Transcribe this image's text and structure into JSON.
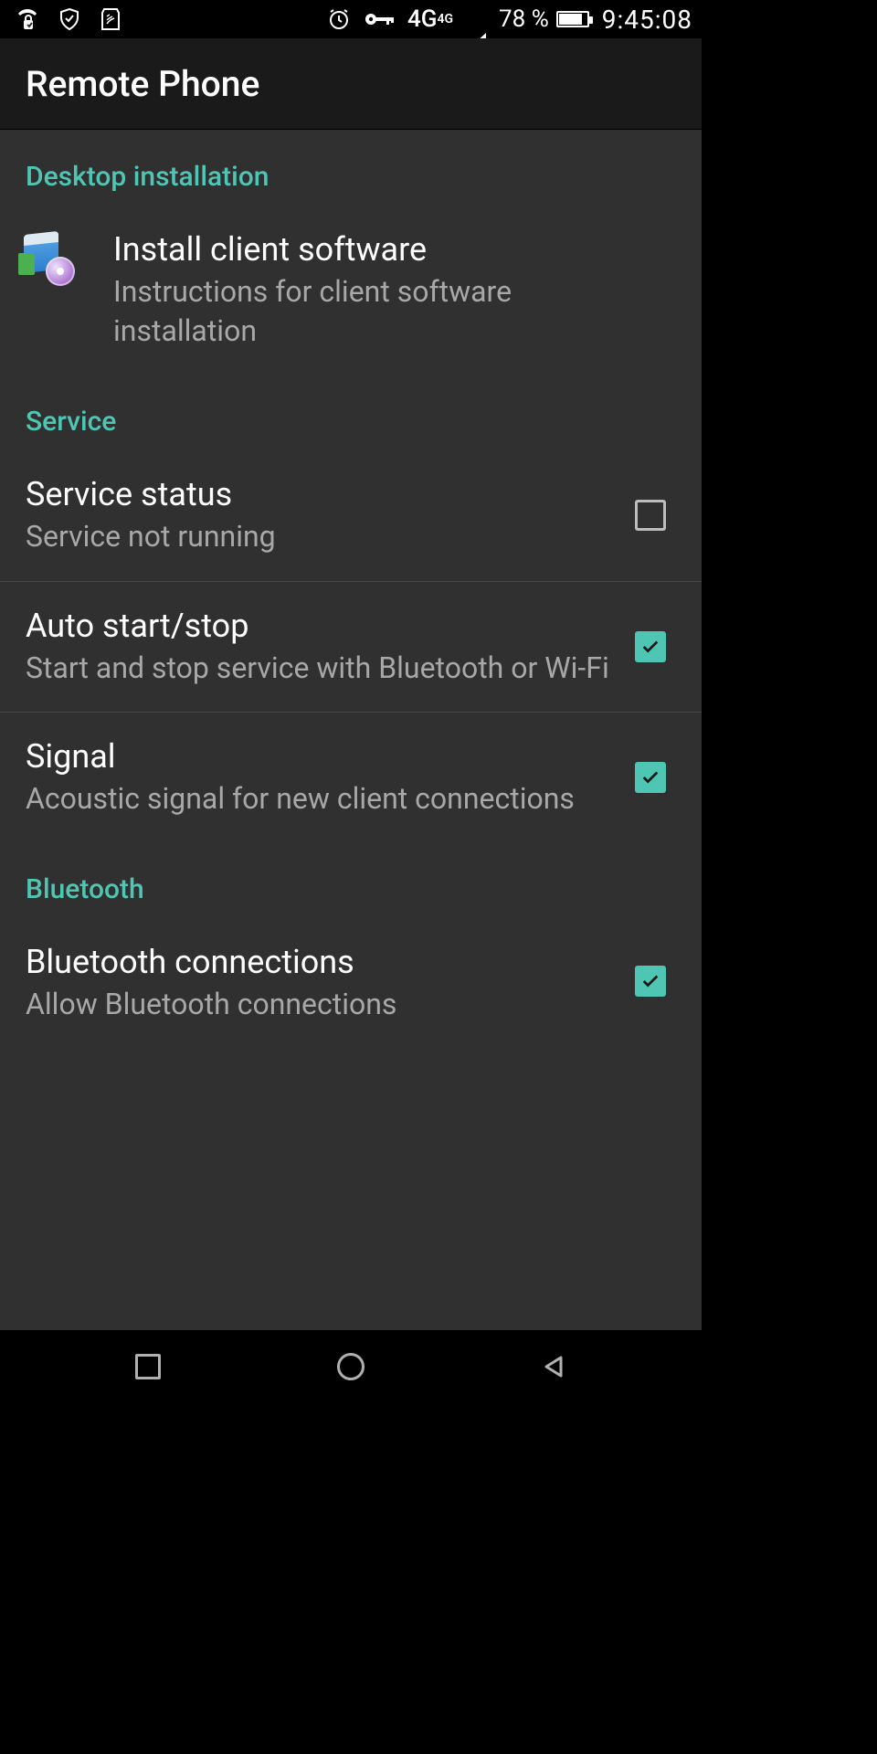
{
  "status": {
    "network_label": "4G",
    "network_sup": "4G",
    "battery_pct": "78 %",
    "time": "9:45:08"
  },
  "app": {
    "title": "Remote Phone"
  },
  "sections": {
    "install": {
      "header": "Desktop installation",
      "item": {
        "title": "Install client software",
        "sub": "Instructions for client software installation"
      }
    },
    "service": {
      "header": "Service",
      "status": {
        "title": "Service status",
        "sub": "Service not running",
        "checked": false
      },
      "auto": {
        "title": "Auto start/stop",
        "sub": "Start and stop service with Bluetooth or Wi-Fi",
        "checked": true
      },
      "signal": {
        "title": "Signal",
        "sub": "Acoustic signal for new client connections",
        "checked": true
      }
    },
    "bluetooth": {
      "header": "Bluetooth",
      "conn": {
        "title": "Bluetooth connections",
        "sub": "Allow Bluetooth connections",
        "checked": true
      }
    }
  }
}
